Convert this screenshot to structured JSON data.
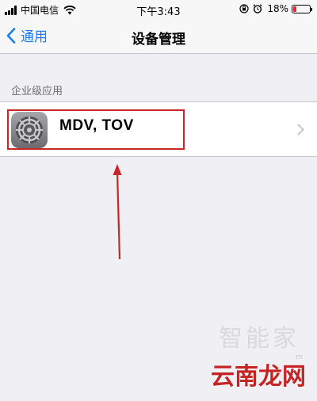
{
  "status_bar": {
    "carrier": "中国电信",
    "time": "下午3:43",
    "battery_percent": "18%",
    "battery_level": 0.18,
    "battery_color": "#e0263a",
    "icons": [
      "signal-icon",
      "wifi-icon",
      "orientation-lock-icon",
      "alarm-icon",
      "battery-icon"
    ]
  },
  "nav": {
    "back_label": "通用",
    "title": "设备管理",
    "accent_color": "#1a7cf6"
  },
  "section": {
    "header": "企业级应用",
    "items": [
      {
        "name": "MDV, TOV",
        "icon": "settings-gear-icon"
      }
    ]
  },
  "annotation": {
    "highlight_color": "#c92626"
  },
  "watermark": {
    "line1": "智能家",
    "line2": "云南龙网",
    "sub": "m"
  }
}
